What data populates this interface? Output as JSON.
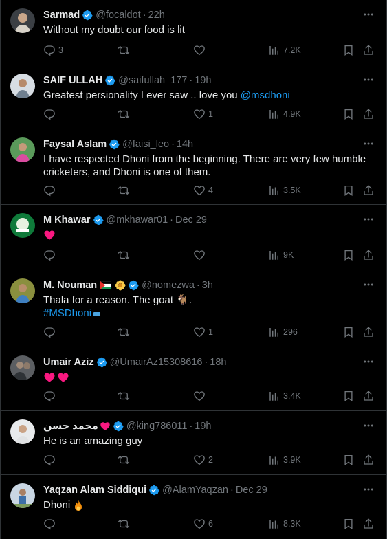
{
  "tweets": [
    {
      "name": "Sarmad",
      "handle": "@focaldot",
      "sep": "·",
      "time": "22h",
      "text": "Without my doubt our food is lit",
      "replies": "3",
      "retweets": "",
      "likes": "",
      "views": "7.2K"
    },
    {
      "name": "SAIF ULLAH",
      "handle": "@saifullah_177",
      "sep": "·",
      "time": "19h",
      "text": "Greatest persionality I ever saw .. love you ",
      "mention": "@msdhoni",
      "replies": "",
      "retweets": "",
      "likes": "1",
      "views": "4.9K"
    },
    {
      "name": "Faysal Aslam",
      "handle": "@faisi_leo",
      "sep": "·",
      "time": "14h",
      "text": "I have respected Dhoni from the beginning. There are very few humble cricketers, and Dhoni is one of them.",
      "replies": "",
      "retweets": "",
      "likes": "4",
      "views": "3.5K"
    },
    {
      "name": "M Khawar",
      "handle": "@mkhawar01",
      "sep": "·",
      "time": "Dec 29",
      "text": "",
      "replies": "",
      "retweets": "",
      "likes": "",
      "views": "9K"
    },
    {
      "name": "M. Nouman",
      "handle": "@nomezwa",
      "sep": "·",
      "time": "3h",
      "text": "Thala for a reason. The goat 🐐.",
      "hashtag": "#MSDhoni",
      "replies": "",
      "retweets": "",
      "likes": "1",
      "views": "296"
    },
    {
      "name": "Umair Aziz",
      "handle": "@UmairAz15308616",
      "sep": "·",
      "time": "18h",
      "text": "",
      "replies": "",
      "retweets": "",
      "likes": "",
      "views": "3.4K"
    },
    {
      "name": "محمد حسن",
      "handle": "@king786011",
      "sep": "·",
      "time": "19h",
      "text": "He is an amazing guy",
      "replies": "",
      "retweets": "",
      "likes": "2",
      "views": "3.9K"
    },
    {
      "name": "Yaqzan Alam Siddiqui",
      "handle": "@AlamYaqzan",
      "sep": "·",
      "time": "Dec 29",
      "text": "Dhoni ",
      "replies": "",
      "retweets": "",
      "likes": "6",
      "views": "8.3K"
    }
  ],
  "colors": {
    "background": "#000000",
    "text": "#e7e9ea",
    "muted": "#71767b",
    "accent": "#1d9bf0",
    "heart": "#f91880",
    "border": "#2f3336"
  }
}
